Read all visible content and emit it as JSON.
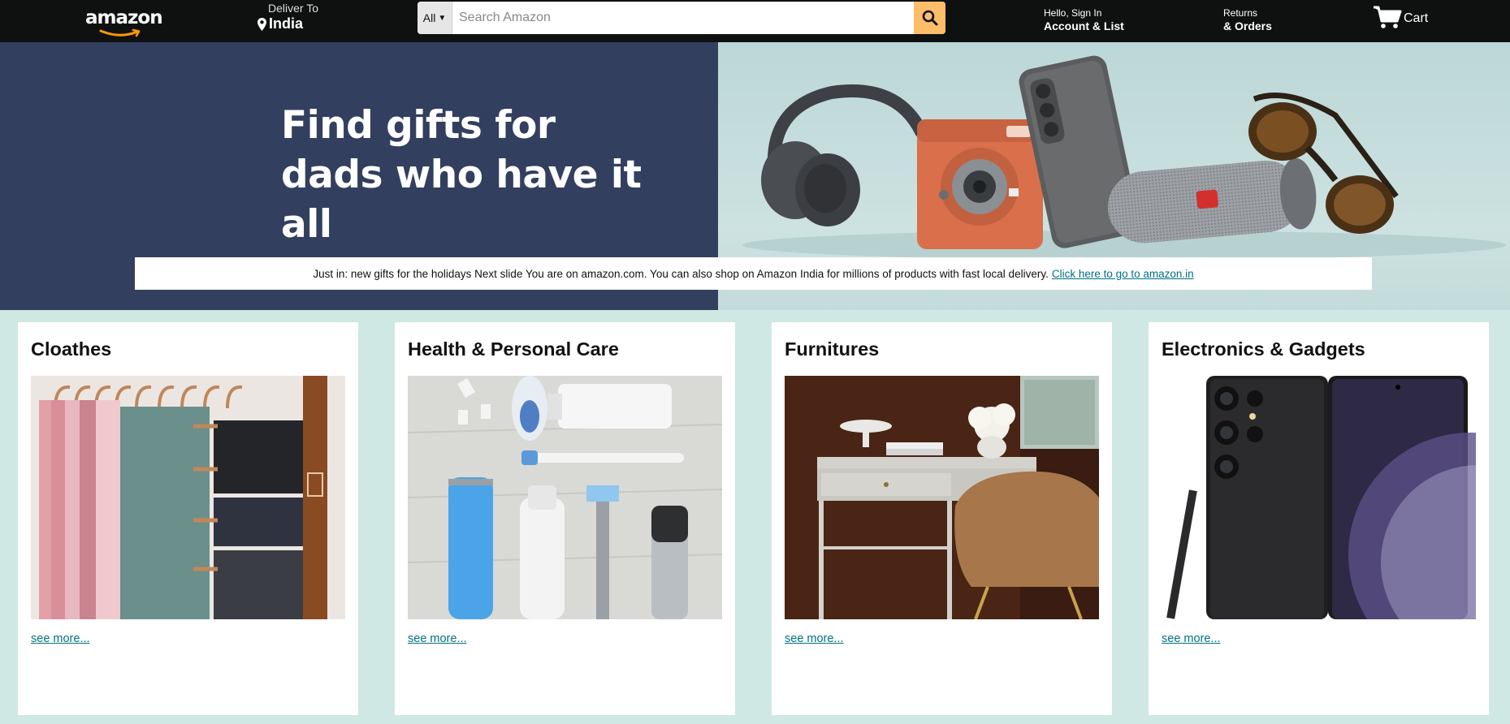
{
  "nav": {
    "logo_text": "amazon",
    "deliver_label": "Deliver To",
    "deliver_location": "India",
    "search_category": "All",
    "search_placeholder": "Search Amazon",
    "account_greeting": "Hello, Sign In",
    "account_label": "Account & List",
    "returns_label": "Returns",
    "orders_label": "& Orders",
    "cart_label": "Cart"
  },
  "hero": {
    "headline_line1": "Find gifts for",
    "headline_line2": "dads who have it all",
    "notice_text": "Just in: new gifts for the holidays Next slide You are on amazon.com. You can also shop on Amazon India for millions of products with fast local delivery.",
    "notice_link": "Click here to go to amazon.in"
  },
  "categories": [
    {
      "title": "Cloathes",
      "link": "see more..."
    },
    {
      "title": "Health & Personal Care",
      "link": "see more..."
    },
    {
      "title": "Furnitures",
      "link": "see more..."
    },
    {
      "title": "Electronics & Gadgets",
      "link": "see more..."
    }
  ],
  "colors": {
    "nav_bg": "#0f1111",
    "hero_left_bg": "#323f5f",
    "search_button": "#febd69",
    "page_bg": "#cfe8e3",
    "link": "#007185"
  },
  "icons": [
    "location-pin-icon",
    "search-icon",
    "cart-icon",
    "amazon-smile-icon"
  ]
}
